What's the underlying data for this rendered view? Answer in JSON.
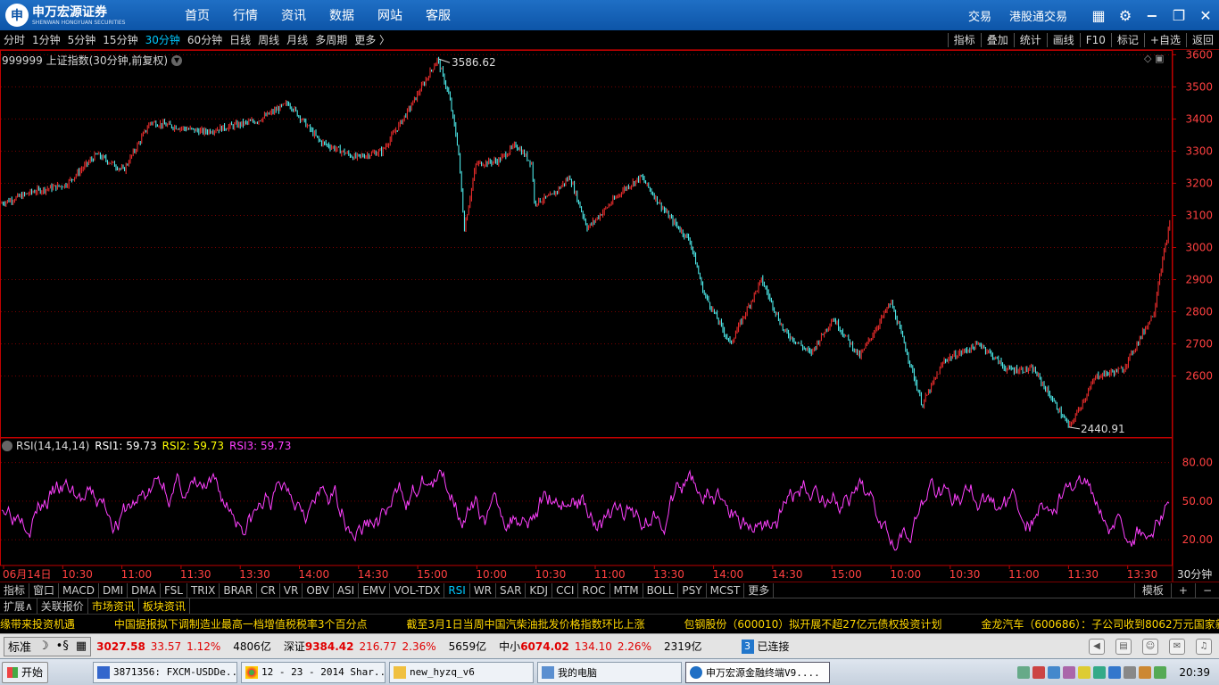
{
  "app": {
    "logo_mark": "申",
    "logo_name": "申万宏源证券",
    "logo_en": "SHENWAN HONGYUAN SECURITIES",
    "menu": [
      "首页",
      "行情",
      "资讯",
      "数据",
      "网站",
      "客服"
    ],
    "right_links": [
      "交易",
      "港股通交易"
    ],
    "window_controls": [
      "grid-icon",
      "gear-icon",
      "minimize-icon",
      "restore-icon",
      "close-icon"
    ]
  },
  "periods": {
    "items": [
      "分时",
      "1分钟",
      "5分钟",
      "15分钟",
      "30分钟",
      "60分钟",
      "日线",
      "周线",
      "月线",
      "多周期",
      "更多 〉"
    ],
    "active": "30分钟",
    "tools": [
      "指标",
      "叠加",
      "统计",
      "画线",
      "F10",
      "标记",
      "+自选",
      "返回"
    ]
  },
  "chart": {
    "label": "999999 上证指数(30分钟,前复权)",
    "rsi_label_name": "RSI(14,14,14)",
    "rsi1": "RSI1: 59.73",
    "rsi2": "RSI2: 59.73",
    "rsi3": "RSI3: 59.73",
    "high_annotation": "3586.62",
    "low_annotation": "2440.91",
    "period_tag": "30分钟",
    "colors": {
      "up": "#ff3030",
      "down": "#54ffff",
      "rsi": "#ff40ff",
      "rsi1": "#ffffff",
      "rsi2": "#ffff00",
      "rsi3": "#ff40ff",
      "axis": "#c00000",
      "grid": "#7a0000"
    }
  },
  "chart_data": {
    "type": "candlestick",
    "title": "999999 上证指数(30分钟,前复权)",
    "y_ticks": [
      3600,
      3500,
      3400,
      3300,
      3200,
      3100,
      3000,
      2900,
      2800,
      2700,
      2600
    ],
    "ylim": [
      2410,
      3615
    ],
    "high": 3586.62,
    "low": 2440.91,
    "x_tick_labels": [
      "06月14日",
      "10:30",
      "11:00",
      "11:30",
      "13:30",
      "14:00",
      "14:30",
      "15:00",
      "10:00",
      "10:30",
      "11:00",
      "13:30",
      "14:00",
      "14:30",
      "15:00",
      "10:00",
      "10:30",
      "11:00",
      "11:30",
      "13:30"
    ],
    "trend_points": [
      [
        0,
        3135
      ],
      [
        40,
        3175
      ],
      [
        75,
        3195
      ],
      [
        110,
        3290
      ],
      [
        140,
        3240
      ],
      [
        170,
        3390
      ],
      [
        230,
        3360
      ],
      [
        290,
        3395
      ],
      [
        325,
        3450
      ],
      [
        360,
        3330
      ],
      [
        400,
        3280
      ],
      [
        430,
        3300
      ],
      [
        460,
        3430
      ],
      [
        492,
        3586.62
      ],
      [
        505,
        3470
      ],
      [
        515,
        3310
      ],
      [
        522,
        3060
      ],
      [
        535,
        3260
      ],
      [
        560,
        3270
      ],
      [
        580,
        3320
      ],
      [
        598,
        3260
      ],
      [
        600,
        3140
      ],
      [
        620,
        3160
      ],
      [
        640,
        3220
      ],
      [
        660,
        3060
      ],
      [
        700,
        3180
      ],
      [
        720,
        3220
      ],
      [
        750,
        3100
      ],
      [
        775,
        3020
      ],
      [
        790,
        2860
      ],
      [
        820,
        2700
      ],
      [
        855,
        2900
      ],
      [
        880,
        2740
      ],
      [
        910,
        2670
      ],
      [
        935,
        2780
      ],
      [
        965,
        2660
      ],
      [
        1000,
        2830
      ],
      [
        1015,
        2700
      ],
      [
        1035,
        2510
      ],
      [
        1060,
        2650
      ],
      [
        1100,
        2700
      ],
      [
        1130,
        2620
      ],
      [
        1160,
        2620
      ],
      [
        1200,
        2440.91
      ],
      [
        1230,
        2600
      ],
      [
        1260,
        2620
      ],
      [
        1295,
        2800
      ],
      [
        1300,
        2900
      ],
      [
        1313,
        3080
      ]
    ],
    "rsi": {
      "name": "RSI(14,14,14)",
      "y_ticks": [
        80.0,
        50.0,
        20.0
      ],
      "ylim": [
        0,
        95
      ],
      "RSI1": 59.73,
      "RSI2": 59.73,
      "RSI3": 59.73
    }
  },
  "indicators": {
    "items": [
      "指标",
      "窗口",
      "MACD",
      "DMI",
      "DMA",
      "FSL",
      "TRIX",
      "BRAR",
      "CR",
      "VR",
      "OBV",
      "ASI",
      "EMV",
      "VOL-TDX",
      "RSI",
      "WR",
      "SAR",
      "KDJ",
      "CCI",
      "ROC",
      "MTM",
      "BOLL",
      "PSY",
      "MCST",
      "更多"
    ],
    "active": "RSI",
    "right": [
      "模板",
      "+",
      "−"
    ]
  },
  "info_tabs": [
    "扩展∧",
    "关联报价",
    "市场资讯",
    "板块资讯"
  ],
  "ticker": [
    "缘带来投资机遇",
    "中国据报拟下调制造业最高一档增值税税率3个百分点",
    "截至3月1日当周中国汽柴油批发价格指数环比上涨",
    "包钢股份（600010）拟开展不超27亿元债权投资计划",
    "金龙汽车（600686）：子公司收到8062万元国家新能源汽"
  ],
  "status": {
    "mode_btns": [
      "标准",
      "☽",
      "•§",
      "▦"
    ],
    "sh_val": "3027.58",
    "sh_chg": "33.57",
    "sh_pct": "1.12%",
    "sh_amt": "4806亿",
    "sz_name": "深证",
    "sz_val": "9384.42",
    "sz_chg": "216.77",
    "sz_pct": "2.36%",
    "sz_amt": "5659亿",
    "zx_name": "中小",
    "zx_val": "6074.02",
    "zx_chg": "134.10",
    "zx_pct": "2.26%",
    "zx_amt": "2319亿",
    "conn_count": "3",
    "conn_text": "已连接"
  },
  "taskbar": {
    "start": "开始",
    "tasks": [
      "3871356: FXCM-USDDe...",
      "12 - 23 - 2014 Shar...",
      "new_hyzq_v6",
      "我的电脑",
      "申万宏源金融终端V9...."
    ],
    "active_index": 4,
    "clock": "20:39"
  }
}
